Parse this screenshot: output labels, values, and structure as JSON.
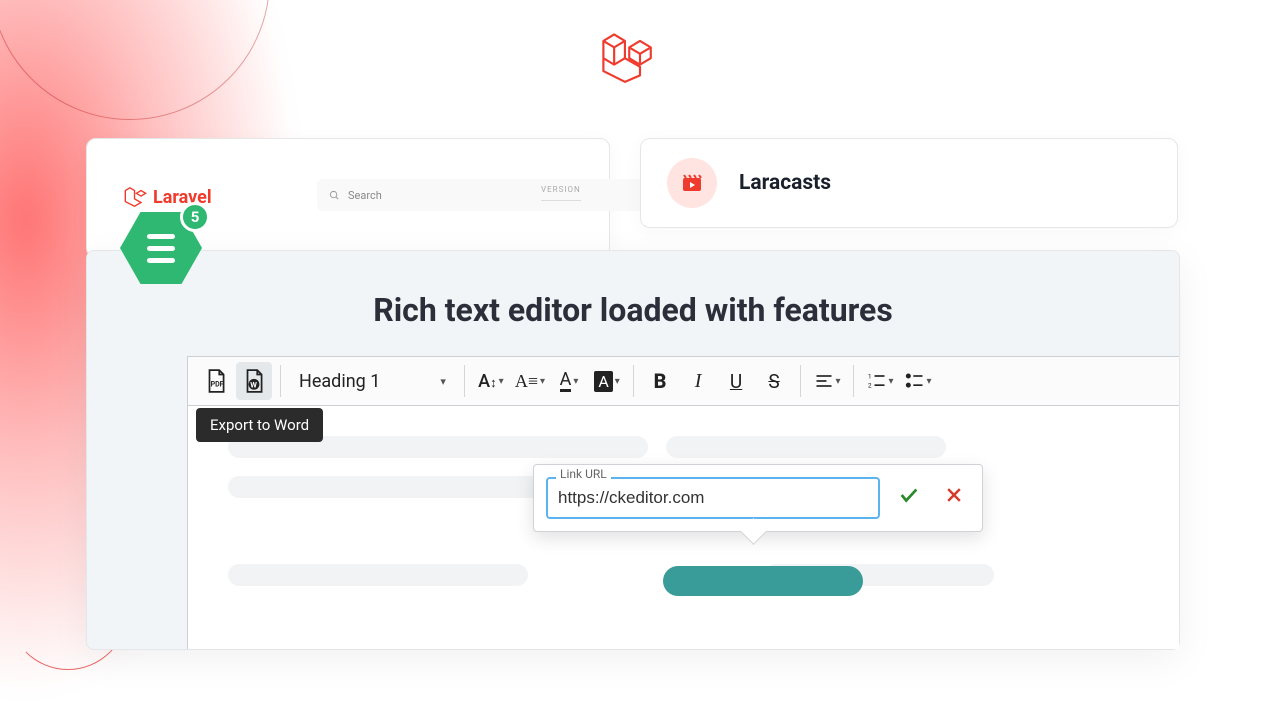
{
  "cards": {
    "laravel_label": "Laravel",
    "search_placeholder": "Search",
    "version_label": "VERSION",
    "laracasts_label": "Laracasts"
  },
  "badge": {
    "number": "5"
  },
  "panel": {
    "title": "Rich text editor loaded with features"
  },
  "toolbar": {
    "heading": "Heading 1",
    "tooltip_export_word": "Export to Word"
  },
  "link_popup": {
    "label": "Link URL",
    "value": "https://ckeditor.com"
  }
}
